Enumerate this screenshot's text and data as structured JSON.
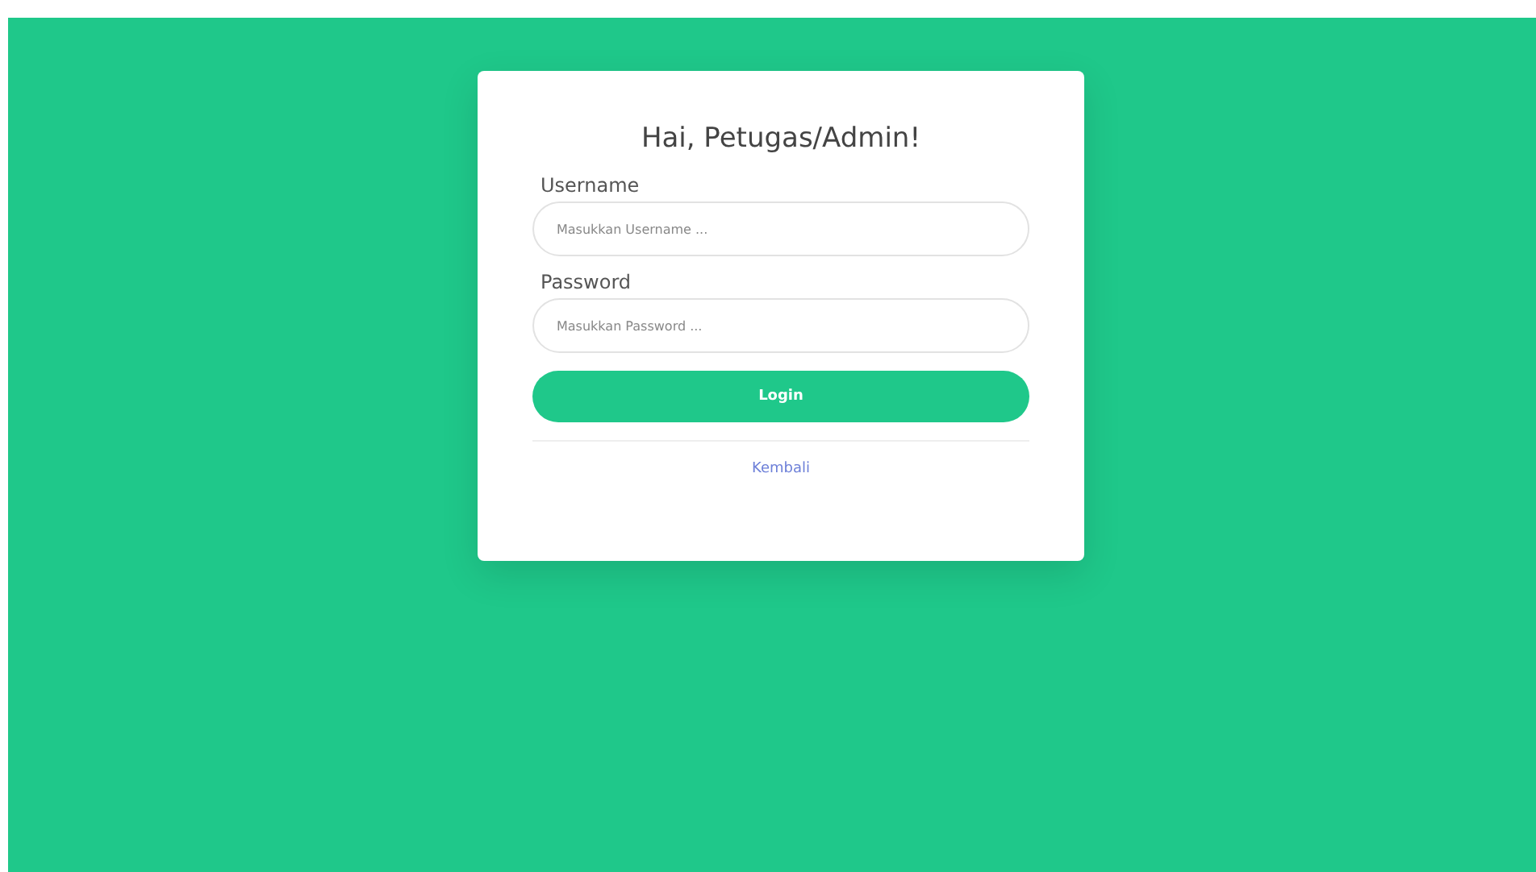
{
  "title": "Hai, Petugas/Admin!",
  "fields": [
    {
      "label": "Username",
      "placeholder": "Masukkan Username ..."
    },
    {
      "label": "Password",
      "placeholder": "Masukkan Password ..."
    }
  ],
  "button": "Login",
  "link": "Kembali"
}
